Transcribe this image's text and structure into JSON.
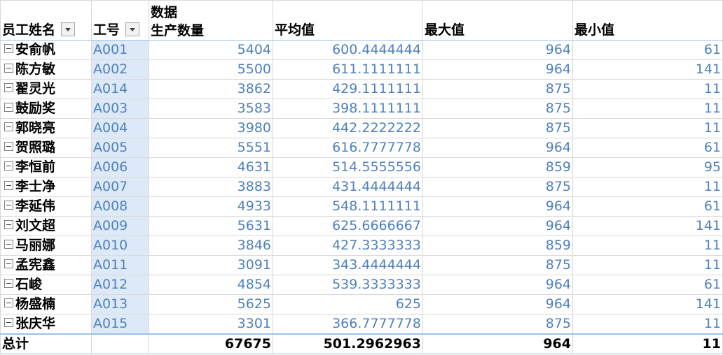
{
  "headers": {
    "employee_name": "员工姓名",
    "employee_id": "工号",
    "data_label": "数据",
    "production_qty": "生产数量",
    "average": "平均值",
    "max": "最大值",
    "min": "最小值"
  },
  "rows": [
    {
      "name": "安俞帆",
      "id": "A001",
      "qty": "5404",
      "avg": "600.4444444",
      "max": "964",
      "min": "61"
    },
    {
      "name": "陈方敏",
      "id": "A002",
      "qty": "5500",
      "avg": "611.1111111",
      "max": "964",
      "min": "141"
    },
    {
      "name": "翟灵光",
      "id": "A014",
      "qty": "3862",
      "avg": "429.1111111",
      "max": "875",
      "min": "11"
    },
    {
      "name": "鼓励奖",
      "id": "A003",
      "qty": "3583",
      "avg": "398.1111111",
      "max": "875",
      "min": "11"
    },
    {
      "name": "郭晓亮",
      "id": "A004",
      "qty": "3980",
      "avg": "442.2222222",
      "max": "875",
      "min": "11"
    },
    {
      "name": "贺照璐",
      "id": "A005",
      "qty": "5551",
      "avg": "616.7777778",
      "max": "964",
      "min": "61"
    },
    {
      "name": "李恒前",
      "id": "A006",
      "qty": "4631",
      "avg": "514.5555556",
      "max": "859",
      "min": "95"
    },
    {
      "name": "李士净",
      "id": "A007",
      "qty": "3883",
      "avg": "431.4444444",
      "max": "875",
      "min": "11"
    },
    {
      "name": "李延伟",
      "id": "A008",
      "qty": "4933",
      "avg": "548.1111111",
      "max": "964",
      "min": "61"
    },
    {
      "name": "刘文超",
      "id": "A009",
      "qty": "5631",
      "avg": "625.6666667",
      "max": "964",
      "min": "141"
    },
    {
      "name": "马丽娜",
      "id": "A010",
      "qty": "3846",
      "avg": "427.3333333",
      "max": "859",
      "min": "11"
    },
    {
      "name": "孟宪鑫",
      "id": "A011",
      "qty": "3091",
      "avg": "343.4444444",
      "max": "875",
      "min": "11"
    },
    {
      "name": "石峻",
      "id": "A012",
      "qty": "4854",
      "avg": "539.3333333",
      "max": "964",
      "min": "61"
    },
    {
      "name": "杨盛楠",
      "id": "A013",
      "qty": "5625",
      "avg": "625",
      "max": "964",
      "min": "141"
    },
    {
      "name": "张庆华",
      "id": "A015",
      "qty": "3301",
      "avg": "366.7777778",
      "max": "875",
      "min": "11"
    }
  ],
  "total": {
    "label": "总计",
    "qty": "67675",
    "avg": "501.2962963",
    "max": "964",
    "min": "11"
  },
  "icons": {
    "expander": "collapse-minus-icon",
    "filter": "dropdown-filter-icon"
  },
  "colors": {
    "value_text": "#4f81bd",
    "id_fill": "#dde9f6",
    "pivot_border": "#9bc2e6"
  }
}
